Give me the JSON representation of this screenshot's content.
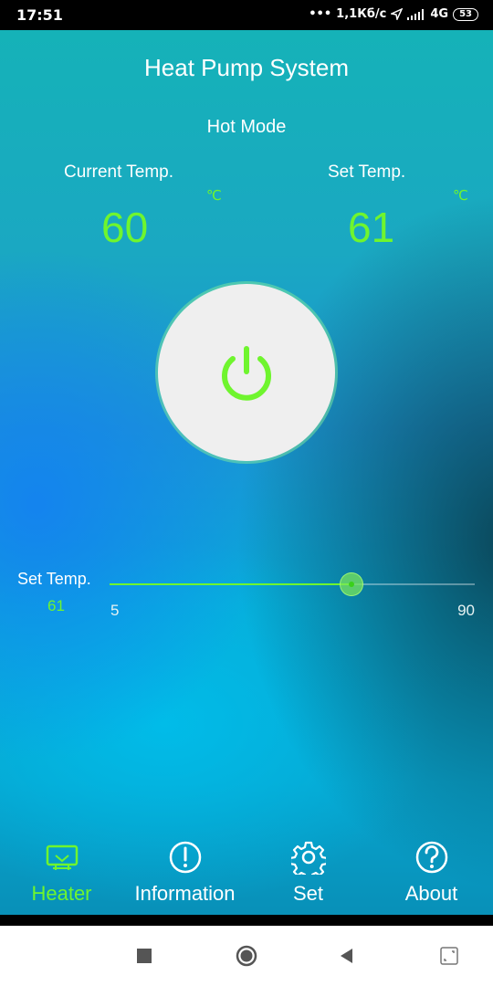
{
  "status_bar": {
    "time": "17:51",
    "network_speed": "1,1Кб/с",
    "network_type": "4G",
    "battery": "53"
  },
  "header": {
    "title": "Heat Pump System",
    "mode": "Hot Mode"
  },
  "current_temp": {
    "label": "Current Temp.",
    "unit": "℃",
    "value": "60"
  },
  "set_temp": {
    "label": "Set Temp.",
    "unit": "℃",
    "value": "61"
  },
  "power_button": {
    "icon": "power-icon",
    "color": "#6ff52e"
  },
  "slider": {
    "label": "Set Temp.",
    "value": "61",
    "min": "5",
    "max": "90",
    "current": 61
  },
  "tabs": [
    {
      "label": "Heater",
      "icon": "heater-icon",
      "active": true
    },
    {
      "label": "Information",
      "icon": "info-icon",
      "active": false
    },
    {
      "label": "Set",
      "icon": "gear-icon",
      "active": false
    },
    {
      "label": "About",
      "icon": "help-icon",
      "active": false
    }
  ],
  "nav": [
    "recents-square-icon",
    "home-circle-icon",
    "back-triangle-icon",
    "screen-rotate-icon"
  ],
  "colors": {
    "accent": "#6ff52e",
    "text": "#ffffff"
  }
}
